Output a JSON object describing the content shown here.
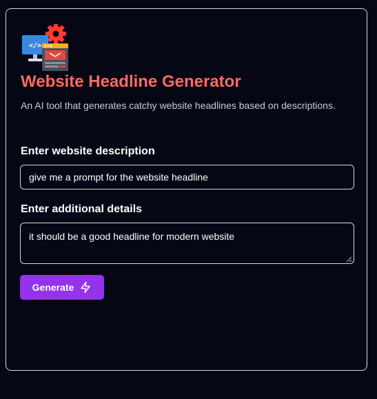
{
  "header": {
    "logo_icon": "web-development-gear-icon",
    "title": "Website Headline Generator",
    "subtitle": "An AI tool that generates catchy website headlines based on descriptions."
  },
  "form": {
    "description_label": "Enter website description",
    "description_value": "give me a prompt for the website headline",
    "details_label": "Enter additional details",
    "details_value": "it should be a good headline for modern website",
    "generate_label": "Generate",
    "generate_icon": "lightning-bolt-icon"
  },
  "colors": {
    "background": "#050714",
    "title": "#ff6a5e",
    "button": "#9333ea",
    "border": "#d7d9df"
  }
}
